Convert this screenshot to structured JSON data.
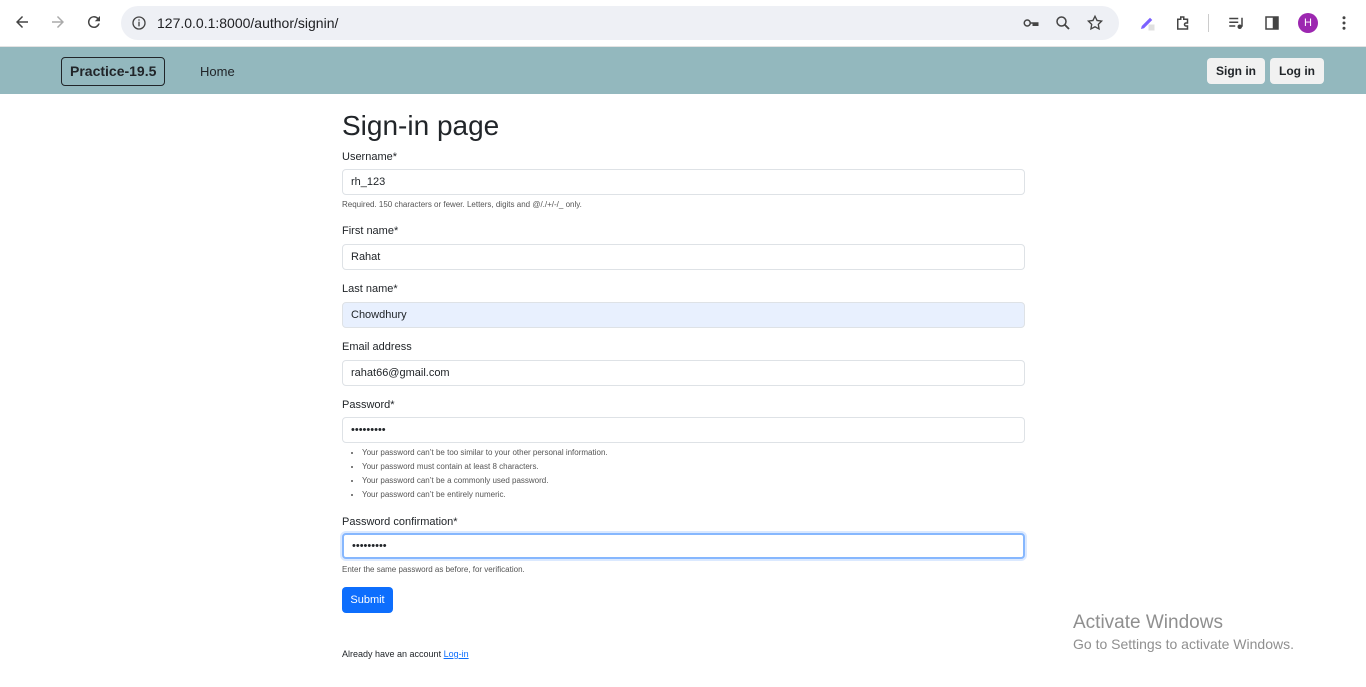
{
  "browser": {
    "url": "127.0.0.1:8000/author/signin/",
    "profile_initial": "H"
  },
  "navbar": {
    "brand": "Practice-19.5",
    "home": "Home",
    "signin": "Sign in",
    "login": "Log in"
  },
  "page": {
    "title": "Sign-in page"
  },
  "form": {
    "username": {
      "label": "Username*",
      "value": "rh_123",
      "help": "Required. 150 characters or fewer. Letters, digits and @/./+/-/_ only."
    },
    "first_name": {
      "label": "First name*",
      "value": "Rahat"
    },
    "last_name": {
      "label": "Last name*",
      "value": "Chowdhury"
    },
    "email": {
      "label": "Email address",
      "value": "rahat66@gmail.com"
    },
    "password": {
      "label": "Password*",
      "value": "•••••••••",
      "rules": [
        "Your password can’t be too similar to your other personal information.",
        "Your password must contain at least 8 characters.",
        "Your password can’t be a commonly used password.",
        "Your password can’t be entirely numeric."
      ]
    },
    "password_confirm": {
      "label": "Password confirmation*",
      "value": "•••••••••",
      "help": "Enter the same password as before, for verification."
    },
    "submit": "Submit",
    "already_text": "Already have an account",
    "login_link": "Log-in"
  },
  "watermark": {
    "line1": "Activate Windows",
    "line2": "Go to Settings to activate Windows."
  },
  "colors": {
    "navbar": "#93b8be",
    "primary": "#0d6efd",
    "autofill": "#e8f0fe"
  }
}
